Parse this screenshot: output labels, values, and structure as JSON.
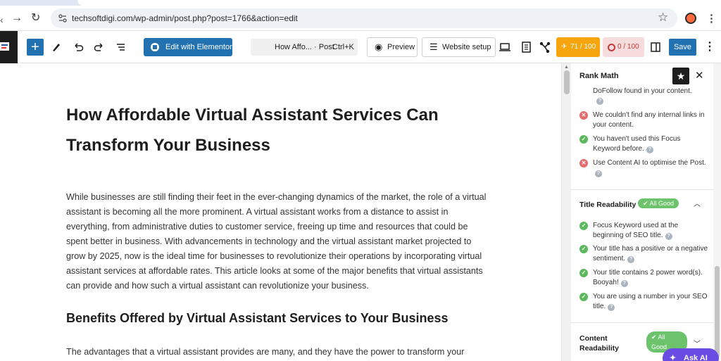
{
  "browser": {
    "url": "techsoftdigi.com/wp-admin/post.php?post=1766&action=edit"
  },
  "toolbar": {
    "elementor_label": "Edit with Elementor",
    "doc_title": "How Affo... · Post",
    "shortcut": "Ctrl+K",
    "preview_label": "Preview",
    "website_setup_label": "Website setup",
    "seo_score": "71 / 100",
    "content_score": "0 / 100",
    "save_label": "Save"
  },
  "post": {
    "title": "How Affordable Virtual Assistant Services Can Transform Your Business",
    "paragraph1": "While businesses are still finding their feet in the ever-changing dynamics of the market, the role of a virtual assistant is becoming all the more prominent. A virtual assistant works from a distance to assist in everything, from administrative duties to customer service, freeing up time and resources that could be spent better in business. With advancements in technology and the virtual assistant market projected to grow by 2025, now is the ideal time for businesses to revolutionize their operations by incorporating virtual assistant services at affordable rates. This article looks at some of the major benefits that virtual assistants can provide and how such a virtual assistant can revolutionize your business.",
    "heading2": "Benefits Offered by Virtual Assistant Services to Your Business",
    "paragraph2": "The advantages that a virtual assistant provides are many, and they have the power to transform your"
  },
  "sidebar": {
    "title": "Rank Math",
    "checks_top": [
      {
        "text": "DoFollow found in your content.",
        "status": "ok"
      },
      {
        "text": "We couldn't find any internal links in your content.",
        "status": "bad"
      },
      {
        "text": "You haven't used this Focus Keyword before.",
        "status": "ok"
      },
      {
        "text": "Use Content AI to optimise the Post.",
        "status": "bad"
      }
    ],
    "title_readability": {
      "label": "Title Readability",
      "badge": "✔ All Good",
      "checks": [
        {
          "text": "Focus Keyword used at the beginning of SEO title.",
          "status": "ok"
        },
        {
          "text": "Your title has a positive or a negative sentiment.",
          "status": "ok"
        },
        {
          "text": "Your title contains 2 power word(s). Booyah!",
          "status": "ok"
        },
        {
          "text": "You are using a number in your SEO title.",
          "status": "ok"
        }
      ]
    },
    "content_readability": {
      "label": "Content Readability",
      "badge": "✔ All Good"
    },
    "ask_ai": "Ask AI"
  },
  "colors": {
    "wp_blue": "#2271b1",
    "seo_orange": "#f7a50c",
    "ok_green": "#5cb85c",
    "bad_red": "#e66b6b",
    "ai_purple": "#6a4be4"
  }
}
